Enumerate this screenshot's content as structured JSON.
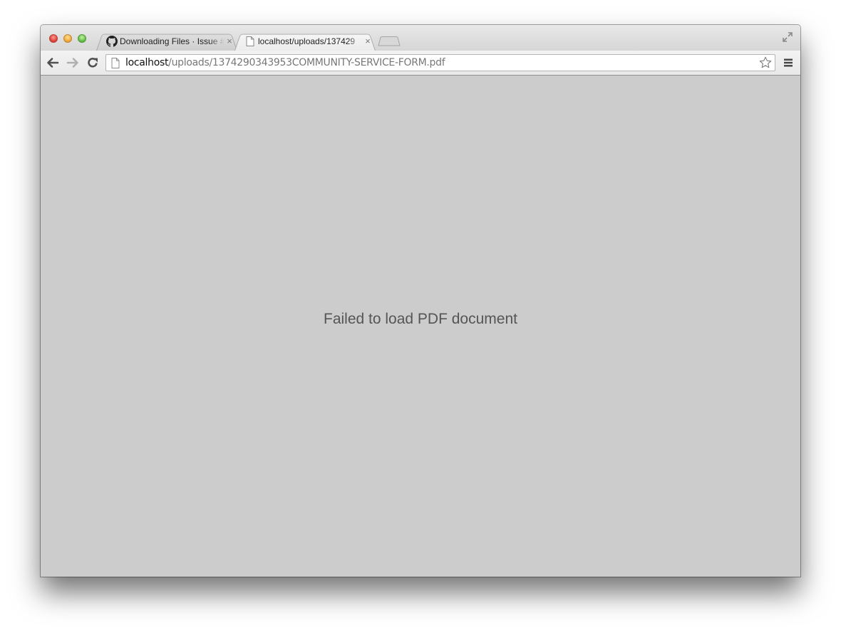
{
  "window": {
    "traffic_lights": [
      "close",
      "minimize",
      "zoom"
    ],
    "fullscreen_icon": "fullscreen-arrows-icon"
  },
  "tabs": [
    {
      "title": "Downloading Files · Issue #",
      "icon": "github-icon",
      "active": false,
      "close_label": "×"
    },
    {
      "title": "localhost/uploads/137429",
      "icon": "page-icon",
      "active": true,
      "close_label": "×"
    }
  ],
  "toolbar": {
    "back_icon": "back-arrow-icon",
    "forward_icon": "forward-arrow-icon",
    "reload_icon": "reload-icon",
    "url_host": "localhost",
    "url_path": "/uploads/1374290343953COMMUNITY-SERVICE-FORM.pdf",
    "bookmark_icon": "star-icon",
    "menu_icon": "hamburger-menu-icon"
  },
  "content": {
    "message": "Failed to load PDF document",
    "background": "#cccccc"
  }
}
